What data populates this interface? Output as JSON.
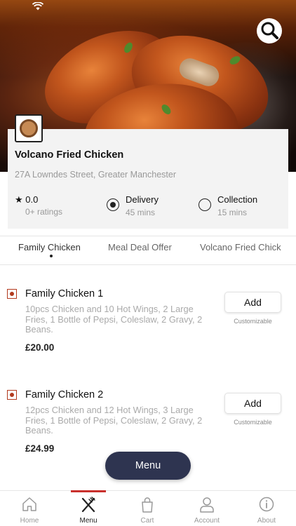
{
  "restaurant": {
    "name": "Volcano Fried Chicken",
    "address": "27A Lowndes Street, Greater Manchester",
    "rating": "0.0",
    "ratings_count": "0+ ratings"
  },
  "order_options": {
    "delivery": {
      "label": "Delivery",
      "time": "45 mins",
      "selected": true
    },
    "collection": {
      "label": "Collection",
      "time": "15 mins",
      "selected": false
    }
  },
  "categories": [
    "Family Chicken",
    "Meal Deal Offer",
    "Volcano Fried Chick"
  ],
  "items": [
    {
      "name": "Family Chicken 1",
      "description": "10pcs Chicken and 10 Hot Wings, 2 Large Fries, 1 Bottle of Pepsi,  Coleslaw, 2 Gravy, 2 Beans.",
      "price": "£20.00",
      "add_label": "Add",
      "customizable": "Customizable"
    },
    {
      "name": "Family Chicken 2",
      "description": "12pcs Chicken and 12 Hot Wings, 3 Large Fries, 1 Bottle of Pepsi,  Coleslaw, 2 Gravy, 2 Beans.",
      "price": "£24.99",
      "add_label": "Add",
      "customizable": "Customizable"
    }
  ],
  "menu_button": "Menu",
  "nav": [
    "Home",
    "Menu",
    "Cart",
    "Account",
    "About"
  ],
  "nav_active": "Menu",
  "colors": {
    "accent_nav": "#c9302c",
    "fab": "#2e3450",
    "veg_marker": "#b23a1e"
  },
  "icons": {
    "search": "search-icon",
    "home": "home-icon",
    "menu": "fork-knife-icon",
    "cart": "shopping-bag-icon",
    "account": "user-icon",
    "about": "info-icon"
  }
}
